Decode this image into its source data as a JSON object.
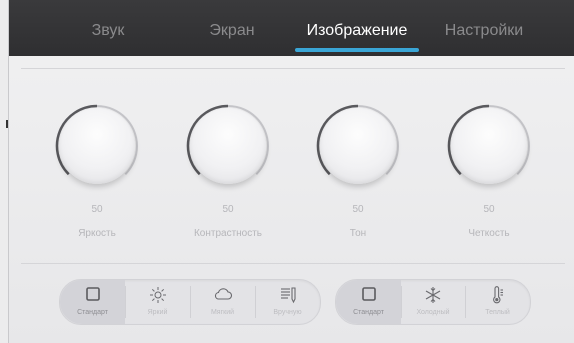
{
  "tabs": [
    {
      "label": "Звук"
    },
    {
      "label": "Экран"
    },
    {
      "label": "Изображение"
    },
    {
      "label": "Настройки"
    }
  ],
  "active_tab": "Изображение",
  "knobs": [
    {
      "value": "50",
      "label": "Яркость"
    },
    {
      "value": "50",
      "label": "Контрастность"
    },
    {
      "value": "50",
      "label": "Тон"
    },
    {
      "value": "50",
      "label": "Четкость"
    }
  ],
  "picture_modes": [
    {
      "label": "Стандарт",
      "icon": "square-icon",
      "selected": true
    },
    {
      "label": "Яркий",
      "icon": "sun-icon",
      "selected": false
    },
    {
      "label": "Мягкий",
      "icon": "cloud-icon",
      "selected": false
    },
    {
      "label": "Вручную",
      "icon": "manual-edit-icon",
      "selected": false
    }
  ],
  "color_temps": [
    {
      "label": "Стандарт",
      "icon": "square-icon",
      "selected": true
    },
    {
      "label": "Холодный",
      "icon": "snowflake-icon",
      "selected": false
    },
    {
      "label": "Теплый",
      "icon": "thermometer-icon",
      "selected": false
    }
  ],
  "colors": {
    "accent": "#3aa6d6",
    "tabbar": "#333335",
    "panel": "#ececed"
  }
}
